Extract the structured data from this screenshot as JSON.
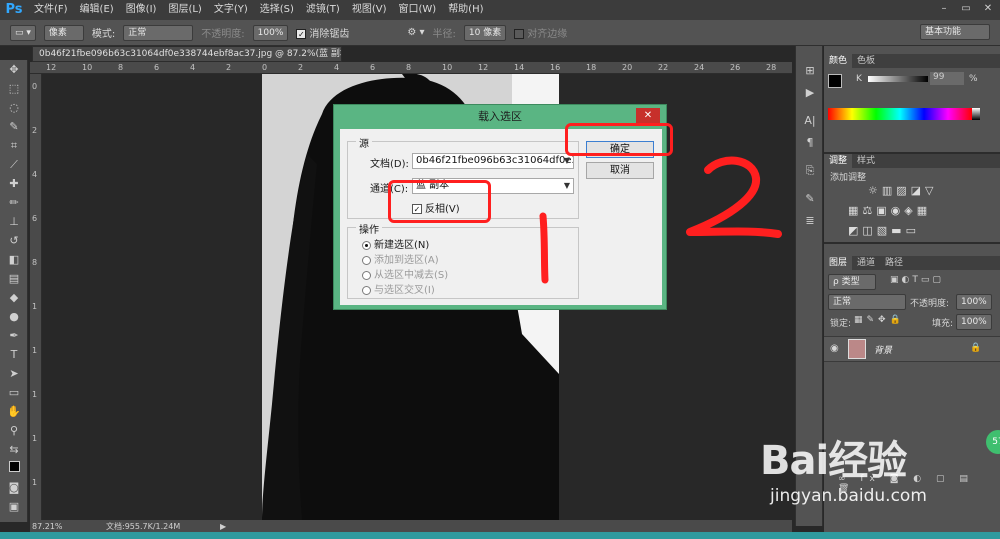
{
  "app": {
    "logo": "Ps"
  },
  "menu": [
    "文件(F)",
    "编辑(E)",
    "图像(I)",
    "图层(L)",
    "文字(Y)",
    "选择(S)",
    "滤镜(T)",
    "视图(V)",
    "窗口(W)",
    "帮助(H)"
  ],
  "window_controls": [
    "–",
    "▭",
    "✕"
  ],
  "options": {
    "feather_label": "像素",
    "mode_label": "模式:",
    "mode_value": "正常",
    "opacity_label": "不透明度:",
    "opacity_value": "100%",
    "antialias_label": "消除锯齿",
    "radius_label": "半径:",
    "radius_value": "10 像素",
    "align_label": "对齐边缘",
    "workspace": "基本功能"
  },
  "document": {
    "tab_title": "0b46f21fbe096b63c31064df0e338744ebf8ac37.jpg @ 87.2%(蓝 副本/8) *  ×"
  },
  "ruler": {
    "top_ticks": [
      "12",
      "10",
      "8",
      "6",
      "4",
      "2",
      "0",
      "2",
      "4",
      "6",
      "8",
      "10",
      "12",
      "14",
      "16",
      "18",
      "20",
      "22",
      "24",
      "26",
      "28"
    ],
    "left_ticks": [
      "0",
      "2",
      "4",
      "6",
      "8",
      "1",
      "1",
      "1",
      "1",
      "1"
    ]
  },
  "status": {
    "zoom": "87.21%",
    "doc_size": "文档:955.7K/1.24M"
  },
  "dialog": {
    "title": "载入选区",
    "close": "✕",
    "source_group": "源",
    "document_label": "文档(D):",
    "document_value": "0b46f21fbe096b63c31064df0e3...",
    "channel_label": "通道(C):",
    "channel_value": "蓝 副本",
    "invert_label": "反相(V)",
    "operation_group": "操作",
    "ok_button": "确定",
    "cancel_button": "取消",
    "operations": [
      "新建选区(N)",
      "添加到选区(A)",
      "从选区中减去(S)",
      "与选区交叉(I)"
    ]
  },
  "annotations": {
    "one": "1",
    "two": "2"
  },
  "color_panel": {
    "tabs": [
      "颜色",
      "色板"
    ],
    "k_label": "K",
    "k_value": "99",
    "k_unit": "%"
  },
  "adjust_panel": {
    "tabs": [
      "调整",
      "样式"
    ],
    "add_label": "添加调整"
  },
  "layers_panel": {
    "tabs": [
      "图层",
      "通道",
      "路径"
    ],
    "filter_label": "ρ 类型",
    "blend_mode": "正常",
    "opacity_label": "不透明度:",
    "opacity_value": "100%",
    "lock_label": "锁定:",
    "fill_label": "填充:",
    "fill_value": "100%",
    "layer_name": "背景"
  },
  "watermark": {
    "logo": "Bai经验",
    "url": "jingyan.baidu.com"
  },
  "taskbar": {
    "badge": "57"
  },
  "colors": {
    "dialog_frame": "#5ab583",
    "annotation": "#ff1f1f",
    "ps_blue": "#31a8ff"
  }
}
